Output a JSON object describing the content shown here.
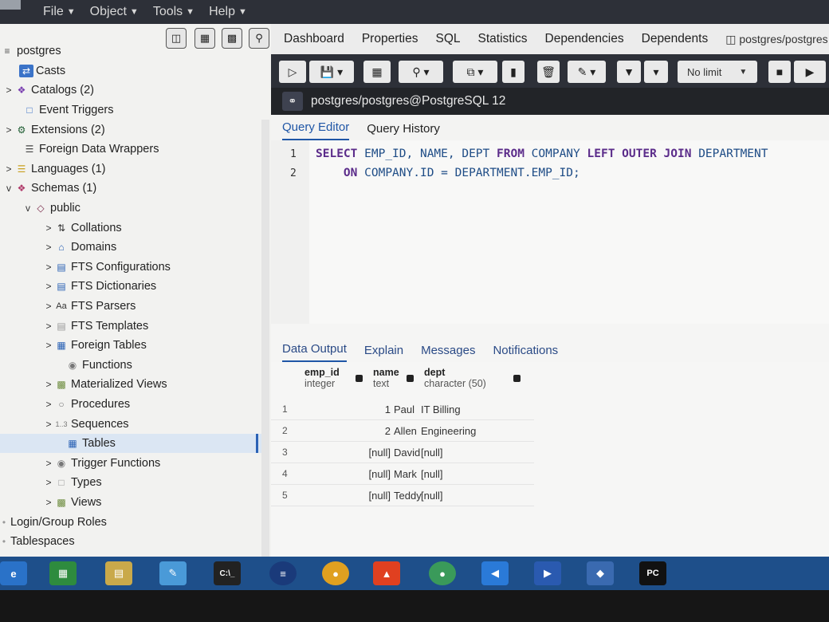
{
  "menubar": {
    "items": [
      {
        "label": "File"
      },
      {
        "label": "Object"
      },
      {
        "label": "Tools"
      },
      {
        "label": "Help"
      }
    ]
  },
  "browser": {
    "root": "postgres",
    "tree": [
      {
        "label": "Casts",
        "icon": "casts-icon",
        "arrow": ""
      },
      {
        "label": "Catalogs (2)",
        "icon": "catalogs-icon",
        "arrow": ">"
      },
      {
        "label": "Event Triggers",
        "icon": "event-triggers-icon",
        "arrow": ""
      },
      {
        "label": "Extensions (2)",
        "icon": "extensions-icon",
        "arrow": ">"
      },
      {
        "label": "Foreign Data Wrappers",
        "icon": "fdw-icon",
        "arrow": ""
      },
      {
        "label": "Languages (1)",
        "icon": "languages-icon",
        "arrow": ">"
      },
      {
        "label": "Schemas (1)",
        "icon": "schemas-icon",
        "arrow": "v"
      },
      {
        "label": "public",
        "icon": "schema-public-icon",
        "arrow": "v"
      },
      {
        "label": "Collations",
        "icon": "collations-icon",
        "arrow": ">"
      },
      {
        "label": "Domains",
        "icon": "domains-icon",
        "arrow": ">"
      },
      {
        "label": "FTS Configurations",
        "icon": "fts-config-icon",
        "arrow": ">"
      },
      {
        "label": "FTS Dictionaries",
        "icon": "fts-dict-icon",
        "arrow": ">"
      },
      {
        "label": "FTS Parsers",
        "icon": "fts-parsers-icon",
        "arrow": ">"
      },
      {
        "label": "FTS Templates",
        "icon": "fts-templates-icon",
        "arrow": ">"
      },
      {
        "label": "Foreign Tables",
        "icon": "foreign-tables-icon",
        "arrow": ">"
      },
      {
        "label": "Functions",
        "icon": "functions-icon",
        "arrow": ""
      },
      {
        "label": "Materialized Views",
        "icon": "mat-views-icon",
        "arrow": ">"
      },
      {
        "label": "Procedures",
        "icon": "procedures-icon",
        "arrow": ">"
      },
      {
        "label": "Sequences",
        "icon": "sequences-icon",
        "arrow": ">"
      },
      {
        "label": "Tables",
        "icon": "tables-icon",
        "arrow": ""
      },
      {
        "label": "Trigger Functions",
        "icon": "trigger-functions-icon",
        "arrow": ">"
      },
      {
        "label": "Types",
        "icon": "types-icon",
        "arrow": ">"
      },
      {
        "label": "Views",
        "icon": "views-icon",
        "arrow": ">"
      },
      {
        "label": "Login/Group Roles",
        "icon": "roles-icon",
        "arrow": ""
      },
      {
        "label": "Tablespaces",
        "icon": "tablespaces-icon",
        "arrow": ""
      }
    ]
  },
  "main": {
    "tabs": [
      {
        "label": "Dashboard"
      },
      {
        "label": "Properties"
      },
      {
        "label": "SQL"
      },
      {
        "label": "Statistics"
      },
      {
        "label": "Dependencies"
      },
      {
        "label": "Dependents"
      },
      {
        "label": "postgres/postgres"
      }
    ],
    "limit": "No limit",
    "connection": "postgres/postgres@PostgreSQL 12",
    "editor_tabs": [
      {
        "label": "Query Editor"
      },
      {
        "label": "Query History"
      }
    ],
    "query": {
      "line1_num": "1",
      "line2_num": "2"
    },
    "output_tabs": [
      {
        "label": "Data Output"
      },
      {
        "label": "Explain"
      },
      {
        "label": "Messages"
      },
      {
        "label": "Notifications"
      }
    ],
    "columns": [
      {
        "name": "emp_id",
        "type": "integer"
      },
      {
        "name": "name",
        "type": "text"
      },
      {
        "name": "dept",
        "type": "character (50)"
      }
    ],
    "rows": [
      {
        "n": "1",
        "emp_id": "1",
        "name": "Paul",
        "dept": "IT Billing"
      },
      {
        "n": "2",
        "emp_id": "2",
        "name": "Allen",
        "dept": "Engineering"
      },
      {
        "n": "3",
        "emp_id": "[null]",
        "name": "David",
        "dept": "[null]"
      },
      {
        "n": "4",
        "emp_id": "[null]",
        "name": "Mark",
        "dept": "[null]"
      },
      {
        "n": "5",
        "emp_id": "[null]",
        "name": "Teddy",
        "dept": "[null]"
      }
    ]
  },
  "taskbar": {
    "cmd_label": "C:\\_",
    "pc_label": "PC"
  }
}
